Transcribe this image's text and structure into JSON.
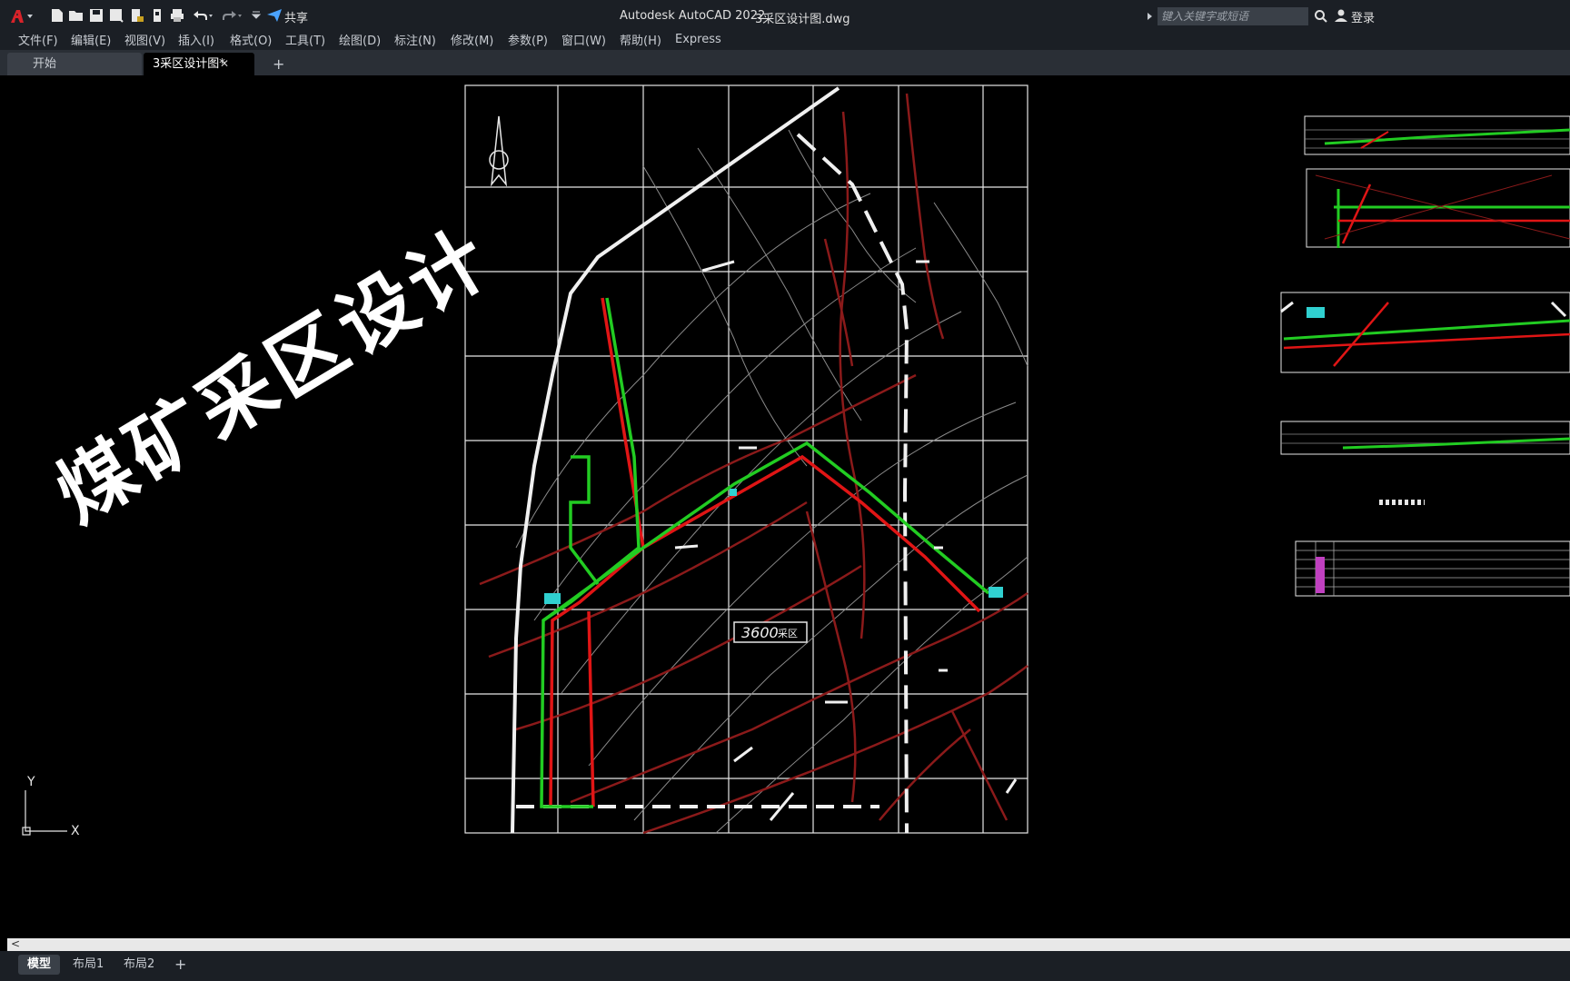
{
  "titlebar": {
    "app_title": "Autodesk AutoCAD 2022",
    "file_title": "3采区设计图.dwg",
    "share_label": "共享",
    "search_placeholder": "键入关键字或短语",
    "login_label": "登录"
  },
  "menu": {
    "items": [
      {
        "label": "文件(F)"
      },
      {
        "label": "编辑(E)"
      },
      {
        "label": "视图(V)"
      },
      {
        "label": "插入(I)"
      },
      {
        "label": "格式(O)"
      },
      {
        "label": "工具(T)"
      },
      {
        "label": "绘图(D)"
      },
      {
        "label": "标注(N)"
      },
      {
        "label": "修改(M)"
      },
      {
        "label": "参数(P)"
      },
      {
        "label": "窗口(W)"
      },
      {
        "label": "帮助(H)"
      },
      {
        "label": "Express"
      }
    ]
  },
  "tabs": {
    "start_label": "开始",
    "doc_label": "3采区设计图*",
    "close_glyph": "✕",
    "add_glyph": "+"
  },
  "drawing": {
    "area_label": "3600",
    "area_suffix": "采区",
    "overlay_text": "煤矿采区设计",
    "axis_x": "X",
    "axis_y": "Y",
    "colors": {
      "background": "#000000",
      "grid": "#e6e6e6",
      "contour": "#8a8a8a",
      "fault": "#8b1a1a",
      "roadway_red": "#e01515",
      "roadway_green": "#22cc22",
      "equipment": "#30d0d0"
    }
  },
  "layout_tabs": {
    "model_label": "模型",
    "layout1_label": "布局1",
    "layout2_label": "布局2",
    "add_glyph": "+"
  },
  "scroll": {
    "left_arrow": "<"
  }
}
